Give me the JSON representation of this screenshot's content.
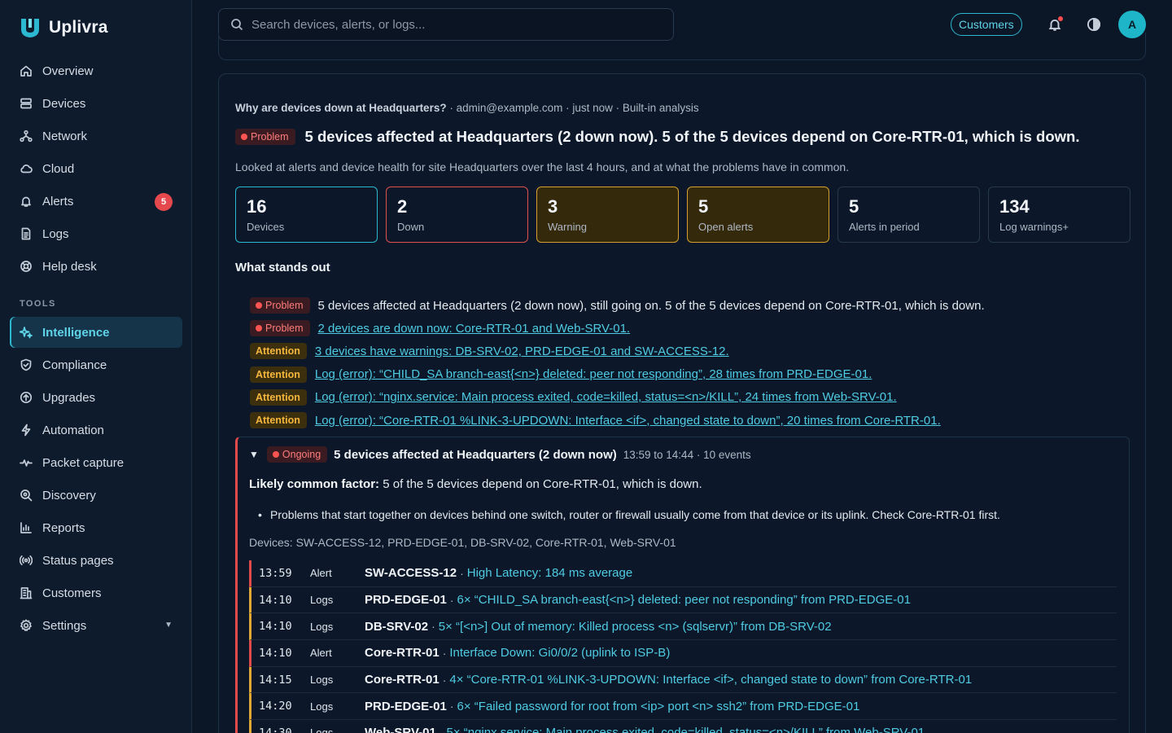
{
  "app": {
    "name": "Uplivra"
  },
  "nav": {
    "items": [
      {
        "label": "Overview",
        "icon": "home-icon"
      },
      {
        "label": "Devices",
        "icon": "server-icon"
      },
      {
        "label": "Network",
        "icon": "network-icon"
      },
      {
        "label": "Cloud",
        "icon": "cloud-icon"
      },
      {
        "label": "Alerts",
        "icon": "bell-icon",
        "badge": "5"
      },
      {
        "label": "Logs",
        "icon": "file-icon"
      },
      {
        "label": "Help desk",
        "icon": "lifebuoy-icon"
      }
    ],
    "tools_label": "TOOLS",
    "tools": [
      {
        "label": "Intelligence",
        "icon": "sparkle-icon",
        "active": true
      },
      {
        "label": "Compliance",
        "icon": "shield-icon"
      },
      {
        "label": "Upgrades",
        "icon": "upgrade-icon"
      },
      {
        "label": "Automation",
        "icon": "bolt-icon"
      },
      {
        "label": "Packet capture",
        "icon": "pulse-icon"
      },
      {
        "label": "Discovery",
        "icon": "discovery-icon"
      },
      {
        "label": "Reports",
        "icon": "chart-icon"
      },
      {
        "label": "Status pages",
        "icon": "broadcast-icon"
      },
      {
        "label": "Customers",
        "icon": "building-icon"
      },
      {
        "label": "Settings",
        "icon": "gear-icon"
      }
    ]
  },
  "topbar": {
    "search_placeholder": "Search devices, alerts, or logs...",
    "customers_button": "Customers",
    "avatar_initial": "A"
  },
  "analysis": {
    "question": "Why are devices down at Headquarters?",
    "meta_rest": " · admin@example.com · just now · Built-in analysis",
    "headline_tag": "Problem",
    "headline": "5 devices affected at Headquarters (2 down now). 5 of the 5 devices depend on Core-RTR-01, which is down.",
    "subtext": "Looked at alerts and device health for site Headquarters over the last 4 hours, and at what the problems have in common.",
    "stats": [
      {
        "value": "16",
        "label": "Devices",
        "style": "cyan"
      },
      {
        "value": "2",
        "label": "Down",
        "style": "red"
      },
      {
        "value": "3",
        "label": "Warning",
        "style": "amber"
      },
      {
        "value": "5",
        "label": "Open alerts",
        "style": "amber"
      },
      {
        "value": "5",
        "label": "Alerts in period",
        "style": "plain"
      },
      {
        "value": "134",
        "label": "Log warnings+",
        "style": "plain"
      }
    ],
    "standout_heading": "What stands out",
    "findings": [
      {
        "tag": "Problem",
        "text": "5 devices affected at Headquarters (2 down now), still going on. 5 of the 5 devices depend on Core-RTR-01, which is down.",
        "link": false
      },
      {
        "tag": "Problem",
        "text": "2 devices are down now: Core-RTR-01 and Web-SRV-01.",
        "link": true
      },
      {
        "tag": "Attention",
        "text": "3 devices have warnings: DB-SRV-02, PRD-EDGE-01 and SW-ACCESS-12.",
        "link": true
      },
      {
        "tag": "Attention",
        "text": "Log (error): “CHILD_SA branch-east{<n>} deleted: peer not responding”, 28 times from PRD-EDGE-01.",
        "link": true
      },
      {
        "tag": "Attention",
        "text": "Log (error): “nginx.service: Main process exited, code=killed, status=<n>/KILL”, 24 times from Web-SRV-01.",
        "link": true
      },
      {
        "tag": "Attention",
        "text": "Log (error): “Core-RTR-01 %LINK-3-UPDOWN: Interface <if>, changed state to down”, 20 times from Core-RTR-01.",
        "link": true
      }
    ],
    "incident": {
      "tag": "Ongoing",
      "title": "5 devices affected at Headquarters (2 down now)",
      "meta": "13:59 to 14:44 · 10 events",
      "factor_label": "Likely common factor:",
      "factor_text": " 5 of the 5 devices depend on Core-RTR-01, which is down.",
      "bullet": "Problems that start together on devices behind one switch, router or firewall usually come from that device or its uplink. Check Core-RTR-01 first.",
      "devices": "Devices: SW-ACCESS-12, PRD-EDGE-01, DB-SRV-02, Core-RTR-01, Web-SRV-01",
      "events": [
        {
          "time": "13:59",
          "type": "Alert",
          "device": "SW-ACCESS-12",
          "message": "High Latency: 184 ms average"
        },
        {
          "time": "14:10",
          "type": "Logs",
          "device": "PRD-EDGE-01",
          "message": "6× “CHILD_SA branch-east{<n>} deleted: peer not responding” from PRD-EDGE-01"
        },
        {
          "time": "14:10",
          "type": "Logs",
          "device": "DB-SRV-02",
          "message": "5× “[<n>] Out of memory: Killed process <n> (sqlservr)” from DB-SRV-02"
        },
        {
          "time": "14:10",
          "type": "Alert",
          "device": "Core-RTR-01",
          "message": "Interface Down: Gi0/0/2 (uplink to ISP-B)"
        },
        {
          "time": "14:15",
          "type": "Logs",
          "device": "Core-RTR-01",
          "message": "4× “Core-RTR-01 %LINK-3-UPDOWN: Interface <if>, changed state to down” from Core-RTR-01"
        },
        {
          "time": "14:20",
          "type": "Logs",
          "device": "PRD-EDGE-01",
          "message": "6× “Failed password for root from <ip> port <n> ssh2” from PRD-EDGE-01"
        },
        {
          "time": "14:30",
          "type": "Logs",
          "device": "Web-SRV-01",
          "message": "5× “nginx.service: Main process exited, code=killed, status=<n>/KILL” from Web-SRV-01"
        }
      ]
    }
  },
  "colors": {
    "accent": "#2bb8d0",
    "problem": "#e24b4a",
    "attention": "#e0a833",
    "background": "#0b1626"
  }
}
